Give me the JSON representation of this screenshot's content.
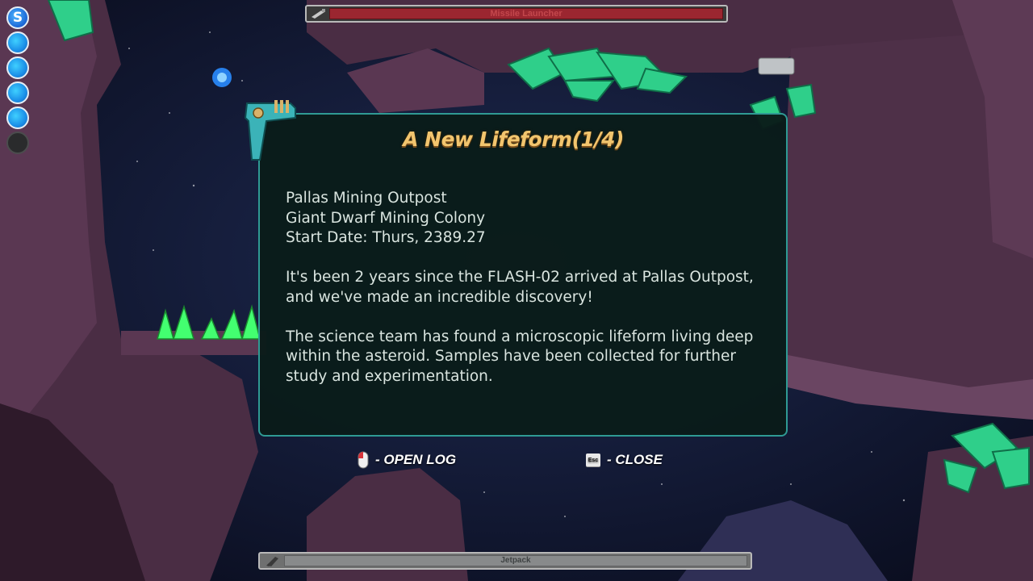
{
  "hud": {
    "weapon_bar_label": "Missile Launcher",
    "jetpack_bar_label": "Jetpack",
    "ability_orb_letter": "S",
    "energy_orbs_filled": 4,
    "energy_orbs_total": 5,
    "weapon_bar_fill": 1.0,
    "jetpack_bar_fill": 1.0
  },
  "dialog": {
    "title": "A New Lifeform(1/4)",
    "header_lines": [
      "Pallas Mining Outpost",
      "Giant Dwarf Mining Colony",
      "Start Date: Thurs, 2389.27"
    ],
    "paragraphs": [
      "It's been 2 years since the FLASH-02 arrived at Pallas Outpost, and we've made an incredible discovery!",
      "The science team has found a microscopic lifeform living deep within the asteroid. Samples have been collected for further study and experimentation."
    ]
  },
  "hints": {
    "open_log_label": "- OPEN LOG",
    "close_label": "- CLOSE",
    "esc_key_label": "Esc",
    "open_log_icon": "mouse-icon",
    "close_icon": "esc-key-icon"
  },
  "colors": {
    "title": "#f2c56e",
    "dialog_border": "#2f9a94",
    "weapon_bar": "#9b2630",
    "energy_orb": "#1b8fe8",
    "crystal": "#2fcf8a"
  }
}
